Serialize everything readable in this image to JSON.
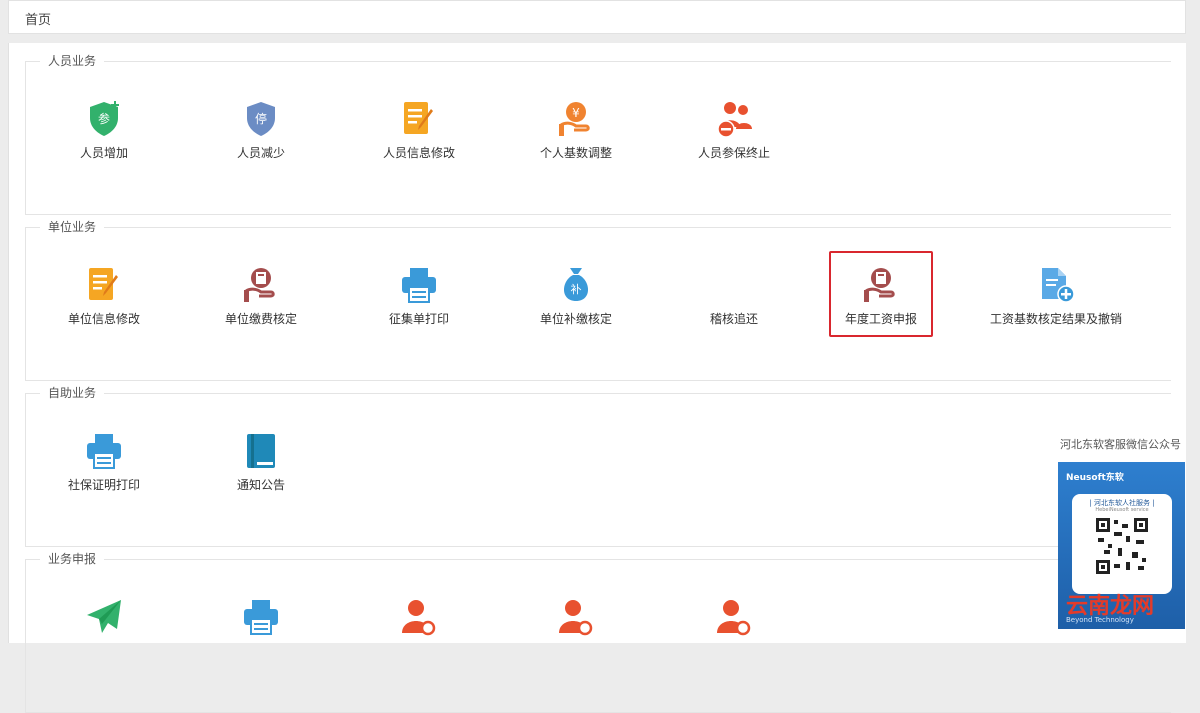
{
  "breadcrumb": {
    "home": "首页"
  },
  "sections": [
    {
      "title": "人员业务",
      "items": [
        {
          "label": "人员增加",
          "icon": "shield-plus-icon"
        },
        {
          "label": "人员减少",
          "icon": "shield-stop-icon"
        },
        {
          "label": "人员信息修改",
          "icon": "edit-document-icon"
        },
        {
          "label": "个人基数调整",
          "icon": "hand-yuan-icon"
        },
        {
          "label": "人员参保终止",
          "icon": "people-minus-icon"
        }
      ]
    },
    {
      "title": "单位业务",
      "items": [
        {
          "label": "单位信息修改",
          "icon": "edit-document-icon"
        },
        {
          "label": "单位缴费核定",
          "icon": "hand-calculator-icon"
        },
        {
          "label": "征集单打印",
          "icon": "printer-icon"
        },
        {
          "label": "单位补缴核定",
          "icon": "money-bag-icon"
        },
        {
          "label": "稽核追还",
          "icon": "blank-icon"
        },
        {
          "label": "年度工资申报",
          "icon": "hand-calculator-icon"
        },
        {
          "label": "工资基数核定结果及撤销",
          "icon": "file-add-icon"
        }
      ]
    },
    {
      "title": "自助业务",
      "items": [
        {
          "label": "社保证明打印",
          "icon": "printer-icon"
        },
        {
          "label": "通知公告",
          "icon": "book-icon"
        }
      ]
    },
    {
      "title": "业务申报",
      "items": [
        {
          "label": "",
          "icon": "paper-plane-icon"
        },
        {
          "label": "",
          "icon": "printer-icon"
        },
        {
          "label": "",
          "icon": "person-search-icon"
        },
        {
          "label": "",
          "icon": "person-search-icon"
        },
        {
          "label": "",
          "icon": "person-search-icon"
        }
      ]
    }
  ],
  "icon_badges": {
    "shield_plus": "参",
    "shield_stop": "停",
    "money_bag": "补"
  },
  "qr_panel": {
    "caption": "河北东软客服微信公众号",
    "brand": "Neusoft东软",
    "title": "| 河北东软人社服务 |",
    "subtitle": "HebeiNeusoft service",
    "footer": "Beyond Technology"
  },
  "watermark": "云南龙网",
  "colors": {
    "highlight": "#d9272e",
    "green": "#32b16c",
    "orange": "#f08330",
    "blue": "#3a9ad9",
    "red": "#e8512f",
    "brown": "#a44d4d",
    "slate": "#6b8cc4"
  }
}
